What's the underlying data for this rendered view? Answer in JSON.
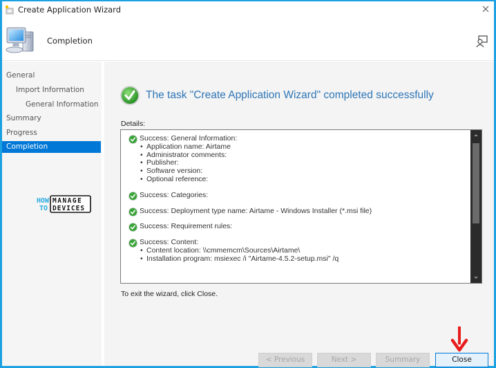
{
  "window": {
    "title": "Create Application Wizard",
    "accent_color": "#1ba1e2"
  },
  "header": {
    "title": "Completion",
    "icon": "computer-icon",
    "feedback_icon": "feedback-icon"
  },
  "sidebar": {
    "items": [
      {
        "label": "General",
        "level": 0,
        "active": false
      },
      {
        "label": "Import Information",
        "level": 1,
        "active": false
      },
      {
        "label": "General Information",
        "level": 2,
        "active": false
      },
      {
        "label": "Summary",
        "level": 0,
        "active": false
      },
      {
        "label": "Progress",
        "level": 0,
        "active": false
      },
      {
        "label": "Completion",
        "level": 0,
        "active": true
      }
    ],
    "active_color": "#0078d7",
    "logo": {
      "how": "HOW",
      "to": "TO",
      "manage": "MANAGE",
      "devices": "DEVICES"
    }
  },
  "main": {
    "success_message": "The task \"Create Application Wizard\" completed successfully",
    "success_color": "#2e75b6",
    "details_label": "Details:",
    "details": [
      {
        "heading": "Success: General Information:",
        "items": [
          "Application name: Airtame",
          "Administrator comments:",
          "Publisher:",
          "Software version:",
          "Optional reference:"
        ]
      },
      {
        "heading": "Success: Categories:",
        "items": []
      },
      {
        "heading": "Success: Deployment type name: Airtame - Windows Installer (*.msi file)",
        "items": []
      },
      {
        "heading": "Success: Requirement rules:",
        "items": []
      },
      {
        "heading": "Success: Content:",
        "items": [
          "Content location: \\\\cmmemcm\\Sources\\Airtame\\",
          "Installation program: msiexec /i \"Airtame-4.5.2-setup.msi\" /q"
        ]
      }
    ],
    "exit_text": "To exit the wizard, click Close."
  },
  "buttons": {
    "previous": "< Previous",
    "next": "Next >",
    "summary": "Summary",
    "close": "Close"
  }
}
